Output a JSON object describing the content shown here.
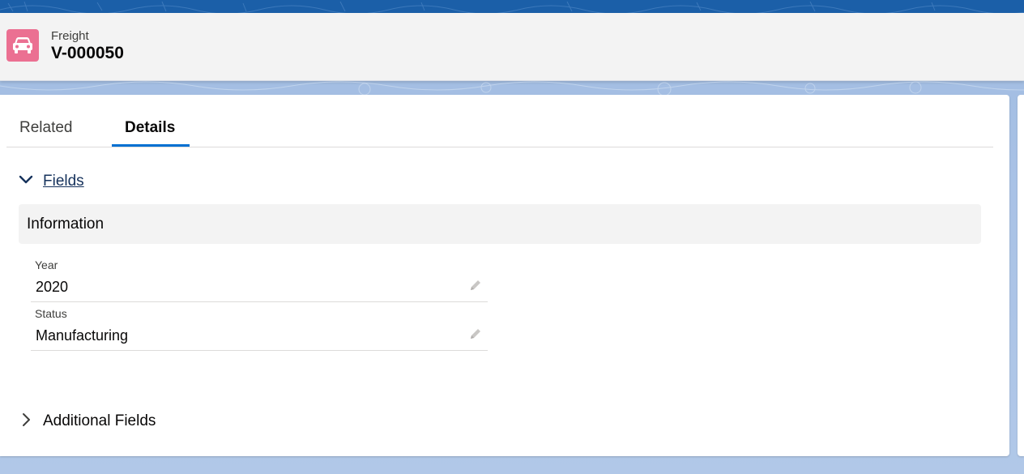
{
  "header": {
    "object_label": "Freight",
    "record_name": "V-000050",
    "icon": "car-icon"
  },
  "tabs": [
    {
      "label": "Related",
      "active": false
    },
    {
      "label": "Details",
      "active": true
    }
  ],
  "sections": {
    "fields": {
      "label": "Fields",
      "expanded": true,
      "info_title": "Information",
      "items": [
        {
          "label": "Year",
          "value": "2020"
        },
        {
          "label": "Status",
          "value": "Manufacturing"
        }
      ]
    },
    "additional": {
      "label": "Additional Fields",
      "expanded": false
    }
  },
  "colors": {
    "brand_blue": "#0070d2",
    "icon_bg": "#eb7092",
    "link": "#16325c"
  }
}
